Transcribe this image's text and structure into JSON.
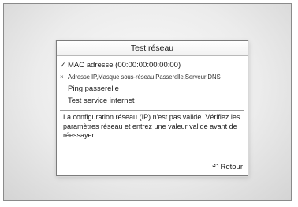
{
  "dialog": {
    "title": "Test réseau",
    "items": [
      {
        "status_mark": "✓",
        "label": "MAC adresse (00:00:00:00:00:00)"
      },
      {
        "status_mark": "×",
        "label": "Adresse IP,Masque sous-réseau,Passerelle,Serveur DNS"
      },
      {
        "status_mark": "",
        "label": "Ping passerelle"
      },
      {
        "status_mark": "",
        "label": "Test service internet"
      }
    ],
    "message": "La configuration réseau (IP) n'est pas valide. Vérifiez les paramètres réseau et entrez une valeur valide avant de réessayer.",
    "return_icon": "↶",
    "return_label": "Retour"
  }
}
